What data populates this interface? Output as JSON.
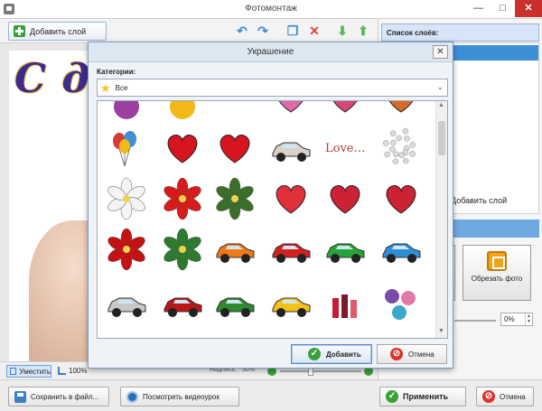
{
  "window": {
    "title": "Фотомонтаж",
    "minimize": "—",
    "maximize": "□",
    "close": "✕"
  },
  "toolbar": {
    "add_layer_label": "Добавить слой",
    "icons": [
      "plus-icon",
      "undo-icon",
      "redo-icon",
      "copy-icon",
      "delete-icon",
      "move-down-icon",
      "move-up-icon"
    ]
  },
  "canvas": {
    "greeting_text": "С дн",
    "fit_label": "Уместить",
    "zoom_value": "100%",
    "opacity_label": "Надпись:",
    "opacity_value": "50%"
  },
  "layers_panel": {
    "header": "Список слоёв:",
    "add_layer_label": "Добавить слой",
    "crop_label": "Обрезать фото",
    "angle_value": "0%",
    "spin_up": "▲",
    "spin_down": "▼"
  },
  "bottom_bar": {
    "save_label": "Сохранить в файл...",
    "video_label": "Посмотреть видеоурок",
    "apply_label": "Применить",
    "cancel_label": "Отмена"
  },
  "dialog": {
    "title": "Украшение",
    "close": "✕",
    "category_label": "Категории:",
    "category_value": "Все",
    "category_icon": "star-icon",
    "add_label": "Добавить",
    "cancel_label": "Отмена",
    "scroll_up": "▲",
    "scroll_down": "▼",
    "gallery": [
      {
        "name": "bird-partial-icon",
        "color": "#9b3fa0"
      },
      {
        "name": "sun-partial-icon",
        "color": "#f2b818"
      },
      {
        "name": "heart-partial-icon",
        "color": "#e06aa8"
      },
      {
        "name": "heart-partial-icon",
        "color": "#d9477a"
      },
      {
        "name": "heart-partial-icon",
        "color": "#d96b2a"
      },
      {
        "name": "balloons-icon",
        "color": "#d63a3a"
      },
      {
        "name": "heart-icon",
        "color": "#d6151e"
      },
      {
        "name": "heart-arrow-icon",
        "color": "#d6151e"
      },
      {
        "name": "card-icon",
        "color": "#d9d2c8"
      },
      {
        "name": "love-text-icon",
        "color": "#b23a3a"
      },
      {
        "name": "pearls-icon",
        "color": "#bfbfbf"
      },
      {
        "name": "white-flower-icon",
        "color": "#f4f4f4"
      },
      {
        "name": "red-hibiscus-icon",
        "color": "#d81a1a"
      },
      {
        "name": "sparkle-flowers-icon",
        "color": "#3a6e2a"
      },
      {
        "name": "small-hearts-icon",
        "color": "#e0303a"
      },
      {
        "name": "hearts-scatter-icon",
        "color": "#cc2233"
      },
      {
        "name": "heart-tree-icon",
        "color": "#cc2233"
      },
      {
        "name": "red-flower-icon",
        "color": "#c41212"
      },
      {
        "name": "green-flower-icon",
        "color": "#2e7a2e"
      },
      {
        "name": "orange-car-icon",
        "color": "#f07a1a"
      },
      {
        "name": "red-car-icon",
        "color": "#d42020"
      },
      {
        "name": "green-car-icon",
        "color": "#2aa23a"
      },
      {
        "name": "blue-car-icon",
        "color": "#2e8fd6"
      },
      {
        "name": "silver-car-icon",
        "color": "#c8c8c8"
      },
      {
        "name": "red-black-car-icon",
        "color": "#b71818"
      },
      {
        "name": "green-cabrio-icon",
        "color": "#2e8a2e"
      },
      {
        "name": "yellow-car-icon",
        "color": "#f2c21a"
      },
      {
        "name": "lipsticks-icon",
        "color": "#c41c3a"
      },
      {
        "name": "makeup-icon",
        "color": "#7a4aa8"
      }
    ]
  }
}
